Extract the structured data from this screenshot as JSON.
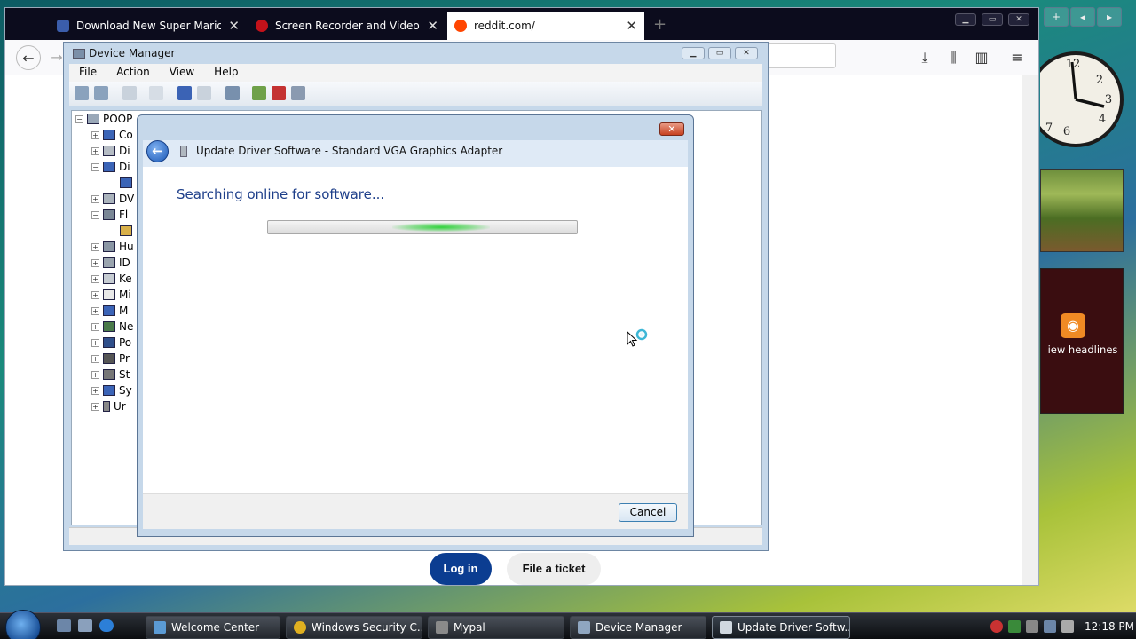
{
  "browser": {
    "tabs": [
      {
        "label": "Download New Super Mario Fo",
        "active": false,
        "favicon_color": "#3b5dab"
      },
      {
        "label": "Screen Recorder and Video Cutt",
        "active": false,
        "favicon_color": "#c4121a"
      },
      {
        "label": "reddit.com/",
        "active": true,
        "favicon_color": "#ff4500"
      }
    ],
    "new_tab_icon": "+",
    "nav": {
      "back_icon": "←",
      "forward_icon": "→"
    },
    "toolbar_icons": [
      "download-icon",
      "library-icon",
      "sidebar-icon",
      "menu-icon"
    ],
    "page": {
      "login_label": "Log in",
      "ticket_label": "File a ticket",
      "login_color": "#0b3d91"
    }
  },
  "sidebar": {
    "feed_text": "iew headlines",
    "rss_icon": "rss-icon"
  },
  "device_manager": {
    "title": "Device Manager",
    "menu": [
      "File",
      "Action",
      "View",
      "Help"
    ],
    "tree_root": "POOP",
    "tree_items": [
      {
        "label": "Co",
        "expander": "+"
      },
      {
        "label": "Di",
        "expander": "+"
      },
      {
        "label": "Di",
        "expander": "−"
      },
      {
        "label": "",
        "expander": ""
      },
      {
        "label": "DV",
        "expander": "+"
      },
      {
        "label": "Fl",
        "expander": "−"
      },
      {
        "label": "",
        "expander": ""
      },
      {
        "label": "Hu",
        "expander": "+"
      },
      {
        "label": "ID",
        "expander": "+"
      },
      {
        "label": "Ke",
        "expander": "+"
      },
      {
        "label": "Mi",
        "expander": "+"
      },
      {
        "label": "M",
        "expander": "+"
      },
      {
        "label": "Ne",
        "expander": "+"
      },
      {
        "label": "Po",
        "expander": "+"
      },
      {
        "label": "Pr",
        "expander": "+"
      },
      {
        "label": "St",
        "expander": "+"
      },
      {
        "label": "Sy",
        "expander": "+"
      },
      {
        "label": "Ur",
        "expander": "+"
      }
    ]
  },
  "dialog": {
    "title": "Update Driver Software - Standard VGA Graphics Adapter",
    "status": "Searching online for software...",
    "progress_state": "indeterminate",
    "cancel_label": "Cancel",
    "close_label": "✕",
    "back_icon": "←"
  },
  "taskbar": {
    "tasks": [
      {
        "label": "Welcome Center",
        "active": false,
        "icon_color": "#5b9bd5"
      },
      {
        "label": "Windows Security C...",
        "active": false,
        "icon_color": "#e0b020"
      },
      {
        "label": "Mypal",
        "active": false,
        "icon_color": "#8a8a8a"
      },
      {
        "label": "Device Manager",
        "active": false,
        "icon_color": "#8fa6c0"
      },
      {
        "label": "Update Driver Softw...",
        "active": true,
        "icon_color": "#d0d8e0"
      }
    ],
    "time": "12:18 PM"
  }
}
